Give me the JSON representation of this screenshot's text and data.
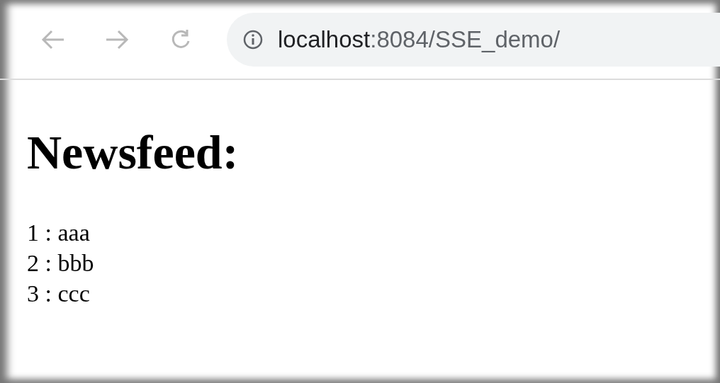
{
  "browser": {
    "url_host": "localhost",
    "url_path": ":8084/SSE_demo/"
  },
  "page": {
    "heading": "Newsfeed:",
    "items": [
      {
        "text": "1 : aaa"
      },
      {
        "text": "2 : bbb"
      },
      {
        "text": "3 : ccc"
      }
    ]
  }
}
